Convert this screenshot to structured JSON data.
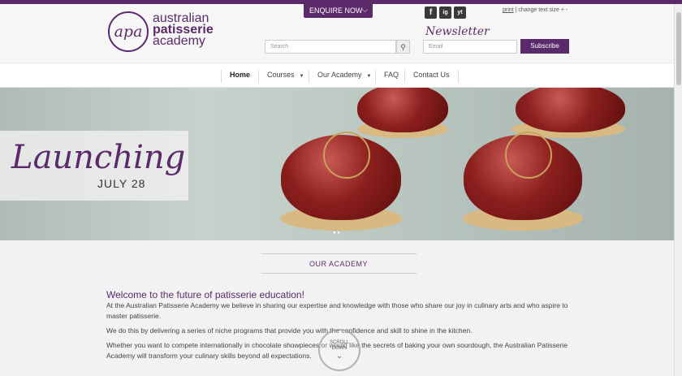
{
  "header": {
    "logo_mark": "apa",
    "logo_line1": "australian",
    "logo_line2": "patisserie",
    "logo_line3": "academy",
    "enquire_label": "ENQUIRE NOW",
    "social": [
      "f",
      "ig",
      "yt"
    ],
    "print_label": "print",
    "text_size_label": " | change text size + -",
    "newsletter_label": "Newsletter",
    "search_placeholder": "Search",
    "email_placeholder": "Email",
    "subscribe_label": "Subscribe"
  },
  "nav": {
    "items": [
      {
        "label": "Home"
      },
      {
        "label": "Courses"
      },
      {
        "label": "Our Academy"
      },
      {
        "label": "FAQ"
      },
      {
        "label": "Contact Us"
      }
    ]
  },
  "hero": {
    "title": "Launching",
    "date": "JULY 28"
  },
  "content": {
    "section_title": "OUR ACADEMY",
    "welcome": "Welcome to the future of patisserie education!",
    "para1": "At the Australian Patisserie Academy we believe in sharing our expertise and knowledge with those who share our joy in culinary arts and who aspire to master patisserie.",
    "para2": "We do this by delivering a series of niche programs that provide you with the confidence and skill to shine in the kitchen.",
    "para3": "Whether you want to compete internationally in chocolate showpieces or would like the secrets of baking your own sourdough, the Australian Patisserie Academy will transform your culinary skills beyond all expectations.",
    "scroll_line1": "SCROLL",
    "scroll_line2": "DOWN"
  },
  "colors": {
    "brand": "#5b2a6b"
  }
}
